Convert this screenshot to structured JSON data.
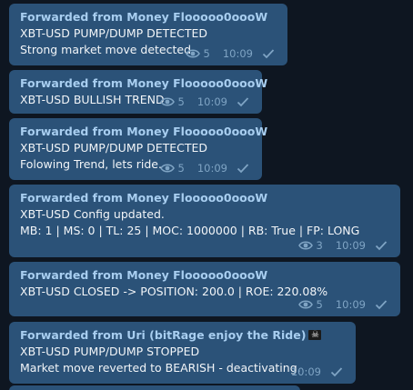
{
  "messages": [
    {
      "forwarded_from": "Forwarded from Money Flooooo0oooW",
      "lines": [
        "XBT-USD PUMP/DUMP DETECTED",
        "Strong market move detected"
      ],
      "views": "5",
      "time": "10:09"
    },
    {
      "forwarded_from": "Forwarded from Money Flooooo0oooW",
      "lines": [
        "XBT-USD BULLISH TREND"
      ],
      "views": "5",
      "time": "10:09"
    },
    {
      "forwarded_from": "Forwarded from Money Flooooo0oooW",
      "lines": [
        "XBT-USD PUMP/DUMP DETECTED",
        "Folowing Trend, lets ride."
      ],
      "views": "5",
      "time": "10:09"
    },
    {
      "forwarded_from": "Forwarded from Money Flooooo0oooW",
      "lines": [
        "XBT-USD Config updated.",
        "MB: 1 | MS: 0 | TL: 25 | MOC: 1000000 | RB: True | FP: LONG"
      ],
      "views": "3",
      "time": "10:09"
    },
    {
      "forwarded_from": "Forwarded from Money Flooooo0oooW",
      "lines": [
        "XBT-USD CLOSED -> POSITION: 200.0 | ROE: 220.08%"
      ],
      "views": "5",
      "time": "10:09"
    },
    {
      "forwarded_from": "Forwarded from Uri (bitRage enjoy the Ride)",
      "lines": [
        "XBT-USD PUMP/DUMP STOPPED",
        "Market move reverted to BEARISH - deactivating."
      ],
      "time": "10:09"
    }
  ],
  "colors": {
    "background": "#0e1621",
    "bubble": "#2b5278",
    "forwarded_name": "#a8cef0",
    "meta": "#7fa4c4"
  },
  "icons": [
    "eye-icon",
    "check-icon",
    "pirate-flag-icon"
  ]
}
